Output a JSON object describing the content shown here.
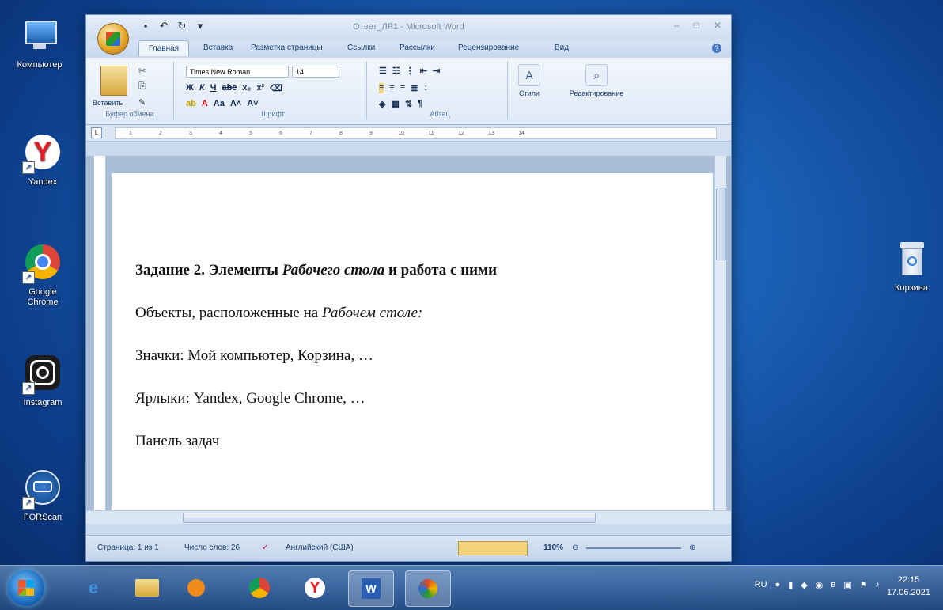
{
  "desktop": {
    "icons": [
      {
        "name": "computer",
        "label": "Компьютер"
      },
      {
        "name": "yandex",
        "label": "Yandex"
      },
      {
        "name": "chrome",
        "label": "Google Chrome"
      },
      {
        "name": "instagram",
        "label": "Instagram"
      },
      {
        "name": "forscan",
        "label": "FORScan"
      },
      {
        "name": "recycle-bin",
        "label": "Корзина"
      }
    ]
  },
  "word": {
    "title": "Ответ_ЛР1 - Microsoft Word",
    "tabs": [
      "Главная",
      "Вставка",
      "Разметка страницы",
      "Ссылки",
      "Рассылки",
      "Рецензирование",
      "Вид"
    ],
    "ribbon": {
      "paste_label": "Вставить",
      "clipboard_label": "Буфер обмена",
      "font_name": "Times New Roman",
      "font_size": "14",
      "font_label": "Шрифт",
      "paragraph_label": "Абзац",
      "styles_label": "Стили",
      "editing_label": "Редактирование"
    },
    "ruler_marks": [
      "1",
      "2",
      "3",
      "4",
      "5",
      "6",
      "7",
      "8",
      "9",
      "10",
      "11",
      "12",
      "13",
      "14"
    ],
    "document": {
      "heading_prefix": "Задание 2. Элементы ",
      "heading_italic": "Рабочего стола",
      "heading_suffix": " и работа с ними",
      "line1_prefix": "Объекты, расположенные на ",
      "line1_italic": "Рабочем столе:",
      "line2": "Значки: Мой компьютер, Корзина, …",
      "line3": "Ярлыки: Yandex, Google Chrome, …",
      "line4": "Панель задач"
    },
    "status": {
      "page": "Страница: 1 из 1",
      "words": "Число слов: 26",
      "language": "Английский (США)",
      "zoom": "110%"
    }
  },
  "taskbar": {
    "language": "RU",
    "time": "22:15",
    "date": "17.06.2021"
  },
  "colors": {
    "desktop": "#1a5fb4",
    "ribbon": "#dfe9f7",
    "accent": "#1c3f72"
  }
}
